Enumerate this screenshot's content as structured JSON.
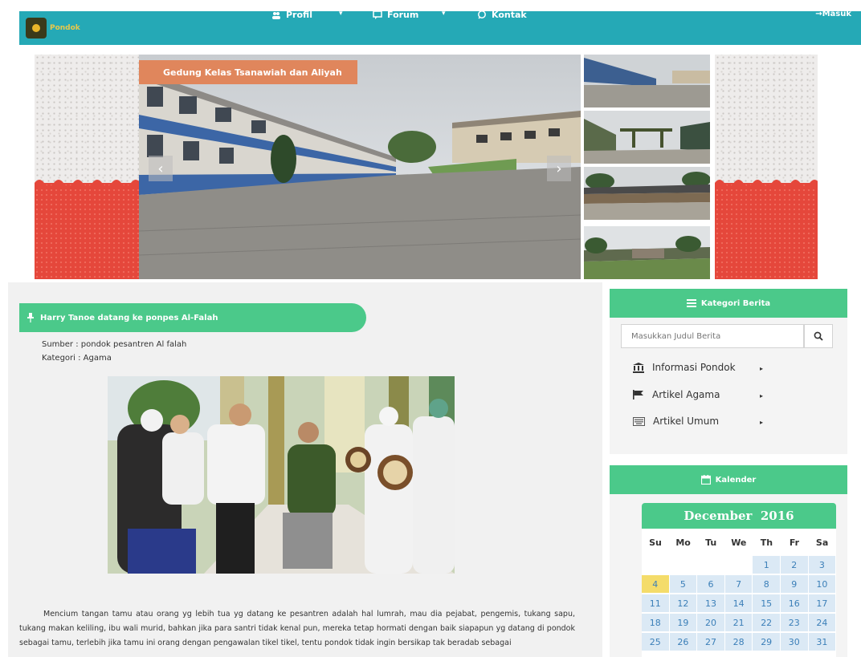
{
  "navbar": {
    "brand": "Pondok",
    "items": [
      {
        "label": "Profil",
        "icon": "users-icon"
      },
      {
        "label": "Forum",
        "icon": "comment-icon"
      },
      {
        "label": "Kontak",
        "icon": "chat-icon"
      }
    ],
    "login": "→Masuk",
    "color": "#25a9b6"
  },
  "slider": {
    "caption": "Gedung Kelas Tsanawiah dan Aliyah",
    "prev": "‹",
    "next": "›"
  },
  "article": {
    "title": "Harry Tanoe datang ke ponpes Al-Falah",
    "sumber": "Sumber : pondok pesantren Al falah",
    "kategori": "Kategori : Agama",
    "body": "Mencium tangan tamu atau orang yg lebih tua yg datang ke pesantren adalah hal lumrah, mau dia pejabat, pengemis, tukang sapu, tukang makan keliling, ibu wali murid, bahkan jika para santri tidak kenal pun, mereka tetap hormati dengan baik siapapun yg datang di pondok sebagai tamu, terlebih jika tamu ini orang dengan pengawalan tikel tikel, tentu pondok tidak ingin bersikap tak beradab sebagai"
  },
  "sidebar": {
    "category_header": "Kategori Berita",
    "search_placeholder": "Masukkan Judul Berita",
    "categories": [
      {
        "label": "Informasi Pondok",
        "icon": "institution-icon"
      },
      {
        "label": "Artikel Agama",
        "icon": "flag-icon"
      },
      {
        "label": "Artikel Umum",
        "icon": "keyboard-icon"
      }
    ],
    "calendar_header": "Kalender"
  },
  "calendar": {
    "month": "December",
    "year": "2016",
    "weekdays": [
      "Su",
      "Mo",
      "Tu",
      "We",
      "Th",
      "Fr",
      "Sa"
    ],
    "weeks": [
      [
        "",
        "",
        "",
        "",
        "1",
        "2",
        "3"
      ],
      [
        "4",
        "5",
        "6",
        "7",
        "8",
        "9",
        "10"
      ],
      [
        "11",
        "12",
        "13",
        "14",
        "15",
        "16",
        "17"
      ],
      [
        "18",
        "19",
        "20",
        "21",
        "22",
        "23",
        "24"
      ],
      [
        "25",
        "26",
        "27",
        "28",
        "29",
        "30",
        "31"
      ]
    ],
    "today": "4"
  },
  "colors": {
    "accent_green": "#4bc98a",
    "caption_orange": "#e0865c",
    "date_blue": "#3b7fb8",
    "today_yellow": "#f4dc6a"
  }
}
